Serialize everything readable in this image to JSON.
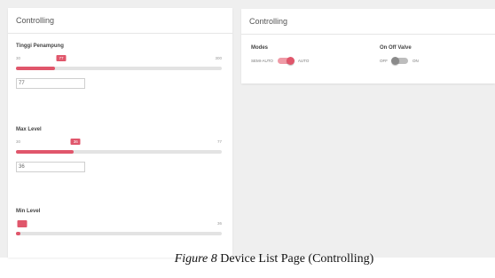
{
  "left_card": {
    "title": "Controlling",
    "sliders": [
      {
        "label": "Tinggi Penampung",
        "min": "30",
        "max": "300",
        "value": "77",
        "fraction": 0.19
      },
      {
        "label": "Max Level",
        "min": "30",
        "max": "77",
        "value": "36",
        "fraction": 0.28
      },
      {
        "label": "Min Level",
        "min": "",
        "max": "36",
        "value": "",
        "fraction": 0.02
      }
    ]
  },
  "right_card": {
    "title": "Controlling",
    "modes": {
      "title": "Modes",
      "left_label": "SEMI-AUTO",
      "right_label": "AUTO",
      "state": "on"
    },
    "valve": {
      "title": "On Off Valve",
      "left_label": "OFF",
      "right_label": "ON",
      "state": "off"
    }
  },
  "caption": {
    "figure": "Figure 8",
    "text": " Device List Page (Controlling)"
  },
  "colors": {
    "accent": "#e0566b",
    "track": "#e3e3e3",
    "background": "#efefef"
  }
}
